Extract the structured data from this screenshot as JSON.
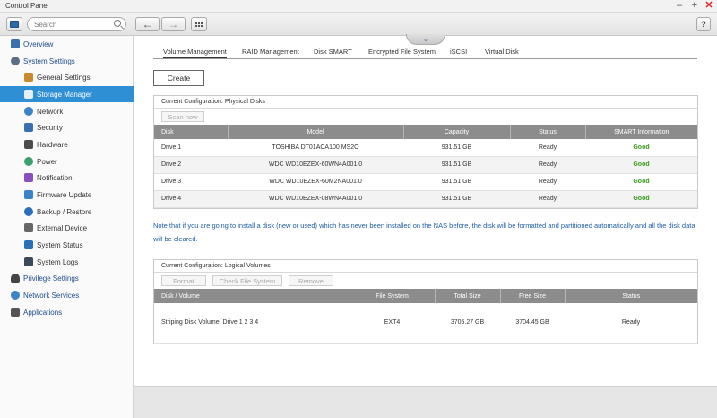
{
  "window": {
    "title": "Control Panel"
  },
  "toolbar": {
    "search_placeholder": "Search",
    "help_label": "?"
  },
  "sidebar": {
    "items": [
      {
        "label": "Overview",
        "level": "top",
        "icon": "overview-icon",
        "color": "#3a6fb0"
      },
      {
        "label": "System Settings",
        "level": "top",
        "icon": "gear-icon",
        "color": "#5a6f85"
      },
      {
        "label": "General Settings",
        "level": "sub",
        "icon": "general-settings-icon",
        "color": "#c98a2b"
      },
      {
        "label": "Storage Manager",
        "level": "sub",
        "icon": "storage-icon",
        "color": "#e8eef6",
        "active": true
      },
      {
        "label": "Network",
        "level": "sub",
        "icon": "network-icon",
        "color": "#3a83c8"
      },
      {
        "label": "Security",
        "level": "sub",
        "icon": "lock-icon",
        "color": "#3a6fb0"
      },
      {
        "label": "Hardware",
        "level": "sub",
        "icon": "hardware-icon",
        "color": "#4b4b4b"
      },
      {
        "label": "Power",
        "level": "sub",
        "icon": "lightbulb-icon",
        "color": "#3aa06c"
      },
      {
        "label": "Notification",
        "level": "sub",
        "icon": "notification-icon",
        "color": "#8a4fbf"
      },
      {
        "label": "Firmware Update",
        "level": "sub",
        "icon": "firmware-icon",
        "color": "#3a83c8"
      },
      {
        "label": "Backup / Restore",
        "level": "sub",
        "icon": "backup-icon",
        "color": "#2b6fb8"
      },
      {
        "label": "External Device",
        "level": "sub",
        "icon": "external-device-icon",
        "color": "#666666"
      },
      {
        "label": "System Status",
        "level": "sub",
        "icon": "monitor-icon",
        "color": "#2b6fb8"
      },
      {
        "label": "System Logs",
        "level": "sub",
        "icon": "logs-icon",
        "color": "#3a4a5a"
      },
      {
        "label": "Privilege Settings",
        "level": "top",
        "icon": "user-icon",
        "color": "#444444"
      },
      {
        "label": "Network Services",
        "level": "top",
        "icon": "globe-icon",
        "color": "#3a83c8"
      },
      {
        "label": "Applications",
        "level": "top",
        "icon": "applications-icon",
        "color": "#555555"
      }
    ]
  },
  "tabs": [
    {
      "label": "Volume Management",
      "active": true
    },
    {
      "label": "RAID Management"
    },
    {
      "label": "Disk SMART"
    },
    {
      "label": "Encrypted File System"
    },
    {
      "label": "iSCSI"
    },
    {
      "label": "Virtual Disk"
    }
  ],
  "create_label": "Create",
  "physical": {
    "header": "Current Configuration: Physical Disks",
    "scan_label": "Scan now",
    "columns": [
      "Disk",
      "Model",
      "Capacity",
      "Status",
      "SMART Information"
    ],
    "rows": [
      {
        "disk": "Drive 1",
        "model": "TOSHIBA DT01ACA100 MS2O",
        "capacity": "931.51 GB",
        "status": "Ready",
        "smart": "Good"
      },
      {
        "disk": "Drive 2",
        "model": "WDC WD10EZEX-60WN4A001.0",
        "capacity": "931.51 GB",
        "status": "Ready",
        "smart": "Good"
      },
      {
        "disk": "Drive 3",
        "model": "WDC WD10EZEX-60M2NA001.0",
        "capacity": "931.51 GB",
        "status": "Ready",
        "smart": "Good"
      },
      {
        "disk": "Drive 4",
        "model": "WDC WD10EZEX-08WN4A001.0",
        "capacity": "931.51 GB",
        "status": "Ready",
        "smart": "Good"
      }
    ]
  },
  "note": "Note that if you are going to install a disk (new or used) which has never been installed on the NAS before, the disk will be formatted and partitioned automatically and all the disk data will be cleared.",
  "logical": {
    "header": "Current Configuration: Logical Volumes",
    "buttons": {
      "format": "Format",
      "check": "Check File System",
      "remove": "Remove"
    },
    "columns": [
      "Disk / Volume",
      "File System",
      "Total Size",
      "Free Size",
      "Status"
    ],
    "rows": [
      {
        "volume": "Striping Disk Volume: Drive 1 2 3 4",
        "fs": "EXT4",
        "total": "3705.27 GB",
        "free": "3704.45 GB",
        "status": "Ready"
      }
    ]
  },
  "colors": {
    "accent": "#2f8fd4",
    "good": "#3a9b1d",
    "link": "#1f5fa8",
    "table_header": "#8c8c8c"
  }
}
